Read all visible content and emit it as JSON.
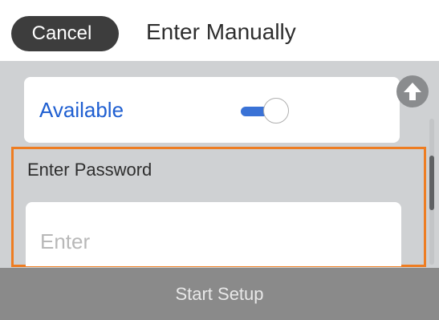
{
  "header": {
    "cancel_label": "Cancel",
    "title": "Enter Manually"
  },
  "available": {
    "label": "Available",
    "toggle_state": "on",
    "toggle_color": "#3a72d6"
  },
  "scroll": {
    "up_icon": "arrow-up-circle-icon"
  },
  "password": {
    "label": "Enter Password",
    "placeholder": "Enter",
    "value": ""
  },
  "footer": {
    "start_label": "Start Setup"
  },
  "colors": {
    "panel_background": "#cfd1d3",
    "focus_border": "#ee7d22",
    "label_blue": "#1f5fd1",
    "footer_disabled": "#8a8a8a"
  }
}
